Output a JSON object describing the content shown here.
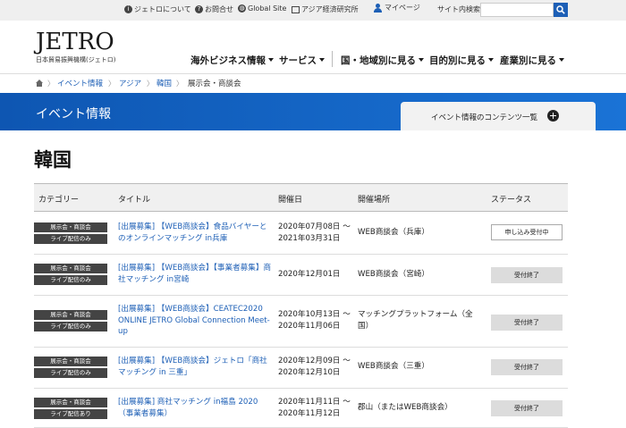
{
  "util": {
    "about": "ジェトロについて",
    "contact": "お問合せ",
    "global_site": "Global Site",
    "ide": "アジア経済研究所",
    "mypage": "マイページ",
    "search_label": "サイト内検索",
    "search_placeholder": ""
  },
  "logo": {
    "main": "JETRO",
    "sub": "日本貿易振興機構(ジェトロ)"
  },
  "gnav": [
    "海外ビジネス情報",
    "サービス",
    "国・地域別に見る",
    "目的別に見る",
    "産業別に見る"
  ],
  "breadcrumb": {
    "items": [
      "イベント情報",
      "アジア",
      "韓国"
    ],
    "current": "展示会・商談会"
  },
  "banner": {
    "title": "イベント情報",
    "tab_label": "イベント情報のコンテンツ一覧"
  },
  "page_title": "韓国",
  "table": {
    "headers": [
      "カテゴリー",
      "タイトル",
      "開催日",
      "開催場所",
      "ステータス"
    ],
    "rows": [
      {
        "cat1": "展示会・商談会",
        "cat2": "ライブ配信のみ",
        "title": "[出展募集] 【WEB商談会】食品バイヤーとのオンラインマッチング in兵庫",
        "date": "2020年07月08日 〜 2021年03月31日",
        "venue": "WEB商談会（兵庫）",
        "status": "申し込み受付中"
      },
      {
        "cat1": "展示会・商談会",
        "cat2": "ライブ配信のみ",
        "title": "[出展募集] 【WEB商談会】【事業者募集】商社マッチング in宮崎",
        "date": "2020年12月01日",
        "venue": "WEB商談会（宮崎）",
        "status": "受付終了"
      },
      {
        "cat1": "展示会・商談会",
        "cat2": "ライブ配信のみ",
        "title": "[出展募集] 【WEB商談会】CEATEC2020 ONLINE JETRO Global Connection Meet-up",
        "date": "2020年10月13日 〜 2020年11月06日",
        "venue": "マッチングプラットフォーム（全国）",
        "status": "受付終了"
      },
      {
        "cat1": "展示会・商談会",
        "cat2": "ライブ配信のみ",
        "title": "[出展募集] 【WEB商談会】ジェトロ「商社マッチング in 三重」",
        "date": "2020年12月09日 〜 2020年12月10日",
        "venue": "WEB商談会（三重）",
        "status": "受付終了"
      },
      {
        "cat1": "展示会・商談会",
        "cat2": "ライブ配信あり",
        "title": "[出展募集] 商社マッチング in福島 2020（事業者募集）",
        "date": "2020年11月11日 〜 2020年11月12日",
        "venue": "郡山（またはWEB商談会）",
        "status": "受付終了"
      }
    ]
  },
  "colors": {
    "accent": "#1d5fb6",
    "banner": "#0e56b2",
    "category_badge": "#444444",
    "status_closed": "#dcdcdc"
  }
}
